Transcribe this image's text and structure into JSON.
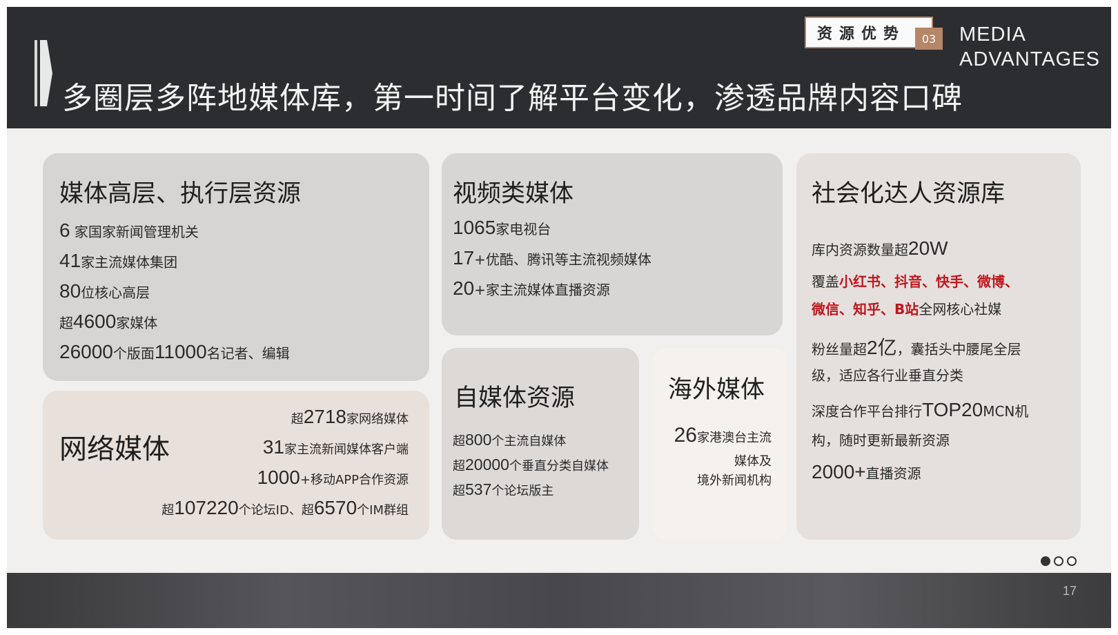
{
  "header": {
    "title": "多圈层多阵地媒体库，第一时间了解平台变化，渗透品牌内容口碑",
    "badge_label": "资源优势",
    "badge_number": "03",
    "media_advantage": "MEDIA ADVANTAGES"
  },
  "cards": {
    "executive": {
      "title": "媒体高层、执行层资源",
      "lines": [
        {
          "num": "6",
          "text": " 家国家新闻管理机关"
        },
        {
          "num": "41",
          "text": "家主流媒体集团"
        },
        {
          "num": "80",
          "text": "位核心高层"
        },
        {
          "pre": "超",
          "num": "4600",
          "text": "家媒体"
        },
        {
          "num": "26000",
          "text": "个版面",
          "num2": "11000",
          "text2": "名记者、编辑"
        }
      ]
    },
    "network": {
      "title": "网络媒体",
      "lines": [
        {
          "pre": "超",
          "num": "2718",
          "text": "家网络媒体"
        },
        {
          "num": "31",
          "text": "家主流新闻媒体客户端"
        },
        {
          "num": "1000",
          "text": "+移动APP合作资源"
        },
        {
          "pre": "超",
          "num": "107220",
          "text": "个论坛ID、超",
          "num2": "6570",
          "text2": "个IM群组"
        }
      ]
    },
    "video": {
      "title": "视频类媒体",
      "lines": [
        {
          "num": "1065",
          "text": "家电视台"
        },
        {
          "num": "17",
          "text": "+优酷、腾讯等主流视频媒体"
        },
        {
          "num": "20",
          "text": "+家主流媒体直播资源"
        }
      ]
    },
    "self_media": {
      "title": "自媒体资源",
      "lines": [
        {
          "pre": "超",
          "num": "800",
          "text": "个主流自媒体"
        },
        {
          "pre": "超",
          "num": "20000",
          "text": "个垂直分类自媒体"
        },
        {
          "pre": "超",
          "num": "537",
          "text": "个论坛版主"
        }
      ]
    },
    "overseas": {
      "title": "海外媒体",
      "num": "26",
      "line1": "家港澳台主流",
      "line2": "媒体及",
      "line3": "境外新闻机构"
    },
    "social": {
      "title": "社会化达人资源库",
      "l1_text": "库内资源数量超",
      "l1_num": "20W",
      "l2_pre": "覆盖",
      "l2_red": "小红书、抖音、快手、微博、",
      "l3_red": "微信、知乎、B站",
      "l3_text": "全网核心社媒",
      "l4_pre": "粉丝量超",
      "l4_num": "2亿",
      "l4_text": "，囊括头中腰尾全层",
      "l5_text": "级，适应各行业垂直分类",
      "l6_pre": "深度合作平台排行",
      "l6_num": "TOP20",
      "l6_text": "MCN机",
      "l7_text": "构，随时更新最新资源",
      "l8_num": "2000+",
      "l8_text": "直播资源"
    }
  },
  "pager": {
    "total": 3,
    "active": 1
  },
  "page_number": "17",
  "colors": {
    "header_bg": "#2c2d30",
    "accent": "#b58667",
    "highlight": "#c0161d"
  }
}
